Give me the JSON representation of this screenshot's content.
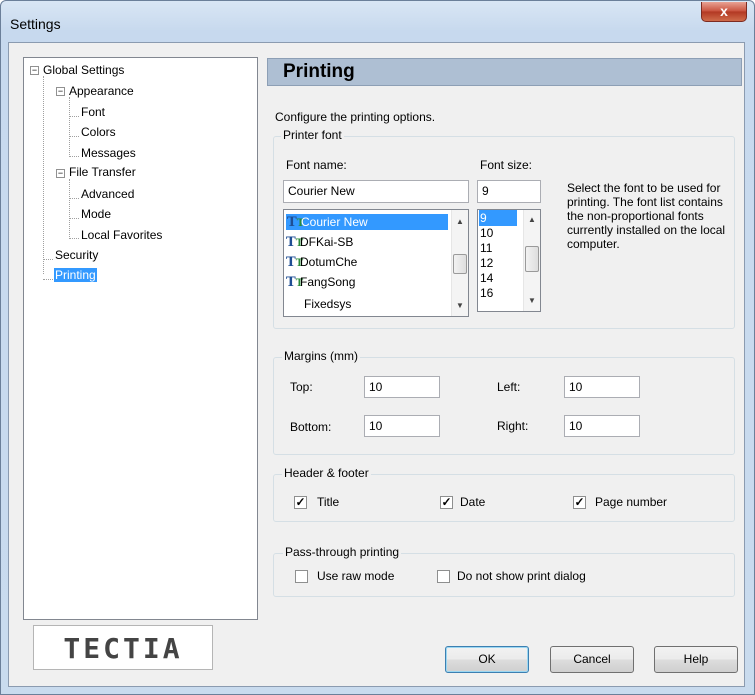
{
  "window": {
    "title": "Settings",
    "close_glyph": "x"
  },
  "tree": {
    "items": [
      {
        "label": "Global Settings"
      },
      {
        "label": "Appearance"
      },
      {
        "label": "Font"
      },
      {
        "label": "Colors"
      },
      {
        "label": "Messages"
      },
      {
        "label": "File Transfer"
      },
      {
        "label": "Advanced"
      },
      {
        "label": "Mode"
      },
      {
        "label": "Local Favorites"
      },
      {
        "label": "Security"
      },
      {
        "label": "Printing"
      }
    ],
    "collapse_glyph": "−"
  },
  "logo": {
    "text": "TECTIA"
  },
  "page": {
    "title": "Printing",
    "description": "Configure the printing options."
  },
  "printer_font": {
    "legend": "Printer font",
    "font_name_label": "Font name:",
    "font_name_value": "Courier New",
    "font_size_label": "Font size:",
    "font_size_value": "9",
    "font_list": [
      {
        "label": "Courier New",
        "icon": "truetype-icon"
      },
      {
        "label": "DFKai-SB",
        "icon": "truetype-icon"
      },
      {
        "label": "DotumChe",
        "icon": "truetype-icon"
      },
      {
        "label": "FangSong",
        "icon": "truetype-icon"
      },
      {
        "label": "Fixedsys",
        "icon": ""
      }
    ],
    "size_list": [
      "9",
      "10",
      "11",
      "12",
      "14",
      "16"
    ],
    "help_text": "Select the font to be used for printing. The font list contains the non-proportional fonts currently installed on the local computer."
  },
  "margins": {
    "legend": "Margins (mm)",
    "top_label": "Top:",
    "top_value": "10",
    "left_label": "Left:",
    "left_value": "10",
    "bottom_label": "Bottom:",
    "bottom_value": "10",
    "right_label": "Right:",
    "right_value": "10"
  },
  "header_footer": {
    "legend": "Header & footer",
    "options": [
      {
        "label": "Title",
        "checked": true
      },
      {
        "label": "Date",
        "checked": true
      },
      {
        "label": "Page number",
        "checked": true
      }
    ]
  },
  "passthrough": {
    "legend": "Pass-through printing",
    "options": [
      {
        "label": "Use raw mode",
        "checked": false
      },
      {
        "label": "Do not show print dialog",
        "checked": false
      }
    ]
  },
  "buttons": {
    "ok": "OK",
    "cancel": "Cancel",
    "help": "Help"
  },
  "colors": {
    "selection": "#3399ff",
    "header_band": "#aebfd3",
    "close_button": "#c8503b"
  }
}
